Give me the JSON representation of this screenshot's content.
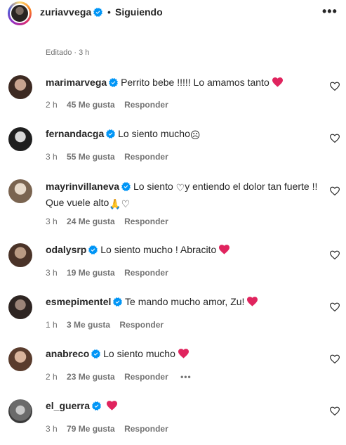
{
  "header": {
    "username": "zuriavvega",
    "separator": "•",
    "follow_status": "Siguiendo",
    "more_label": "•••"
  },
  "edited_label": "Editado · 3 h",
  "reply_label": "Responder",
  "comments": [
    {
      "username": "marimarvega",
      "text": "Perrito bebe !!!!! Lo amamos tanto",
      "time": "2 h",
      "likes": "45 Me gusta",
      "emoji": "red-heart"
    },
    {
      "username": "fernandacga",
      "text": "Lo siento mucho",
      "time": "3 h",
      "likes": "55 Me gusta",
      "emoji": "sad-face"
    },
    {
      "username": "mayrinvillaneva",
      "text": "Lo siento",
      "text2": "y entiendo el dolor tan fuerte !! Que vuele alto",
      "time": "3 h",
      "likes": "24 Me gusta",
      "emoji": "white-heart, praying-hands, white-heart"
    },
    {
      "username": "odalysrp",
      "text": "Lo siento mucho ! Abracito",
      "time": "3 h",
      "likes": "19 Me gusta",
      "emoji": "red-heart"
    },
    {
      "username": "esmepimentel",
      "text": "Te mando mucho amor, Zu!",
      "time": "1 h",
      "likes": "3 Me gusta",
      "emoji": "red-heart"
    },
    {
      "username": "anabreco",
      "text": "Lo siento mucho",
      "time": "2 h",
      "likes": "23 Me gusta",
      "emoji": "red-heart",
      "more": "•••"
    },
    {
      "username": "el_guerra",
      "text": "",
      "time": "3 h",
      "likes": "79 Me gusta",
      "emoji": "red-heart"
    }
  ],
  "colors": {
    "verified": "#0095f6",
    "heart": "#e0245e",
    "muted": "#737373"
  }
}
